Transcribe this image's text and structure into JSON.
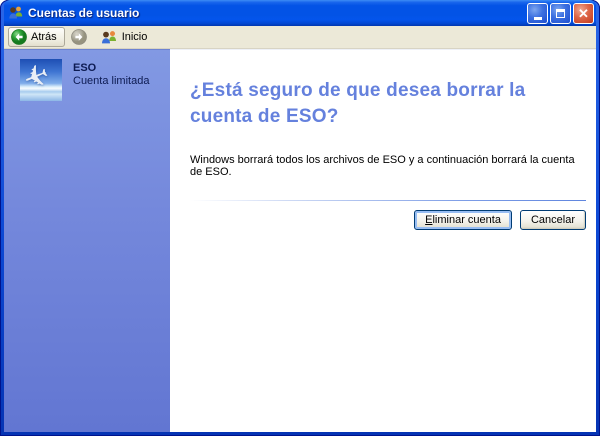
{
  "window": {
    "title": "Cuentas de usuario"
  },
  "icons": {
    "app_icon": "user-accounts-two-people",
    "close_glyph": "✕",
    "user_picture_glyph": "✈"
  },
  "toolbar": {
    "back_label": "Atrás",
    "home_label": "Inicio"
  },
  "sidebar": {
    "account_name": "ESO",
    "account_type": "Cuenta limitada"
  },
  "main": {
    "heading": "¿Está seguro de que desea borrar la cuenta de ESO?",
    "body": "Windows borrará todos los archivos de ESO y a continuación borrará la cuenta de ESO.",
    "buttons": {
      "delete_mnemonic": "E",
      "delete_label_rest": "liminar cuenta",
      "cancel_label": "Cancelar"
    }
  },
  "colors": {
    "titlebar_blue": "#0353e6",
    "toolbar_bg": "#ece9d8",
    "sidebar_top": "#8299e3",
    "sidebar_bottom": "#6276d2",
    "heading_text": "#6581dd",
    "button_border": "#003c74"
  }
}
